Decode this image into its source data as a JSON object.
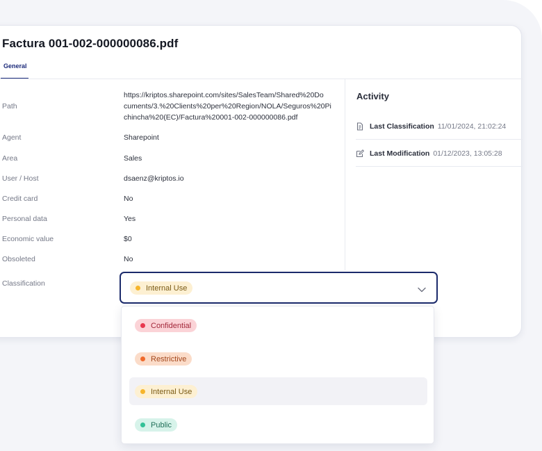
{
  "document": {
    "title": "Factura 001-002-000000086.pdf",
    "tab_general": "General"
  },
  "fields": [
    {
      "label": "Path",
      "value": "https://kriptos.sharepoint.com/sites/SalesTeam/Shared%20Documents/3.%20Clients%20per%20Region/NOLA/Seguros%20Pichincha%20(EC)/Factura%20001-002-000000086.pdf"
    },
    {
      "label": "Agent",
      "value": "Sharepoint"
    },
    {
      "label": "Area",
      "value": "Sales"
    },
    {
      "label": "User / Host",
      "value": "dsaenz@kriptos.io"
    },
    {
      "label": "Credit card",
      "value": "No"
    },
    {
      "label": "Personal data",
      "value": "Yes"
    },
    {
      "label": "Economic value",
      "value": "$0"
    },
    {
      "label": "Obsoleted",
      "value": "No"
    },
    {
      "label": "Classification",
      "value": ""
    }
  ],
  "path_lines": [
    "https://kriptos.sharepoint.com/sites/SalesTeam/Shared%20Do",
    "cuments/3.%20Clients%20per%20Region/NOLA/Seguros%20Pi",
    "chincha%20(EC)/Factura%20001-002-000000086.pdf"
  ],
  "activity": {
    "title": "Activity",
    "items": [
      {
        "label": "Last Classification",
        "date": "11/01/2024, 21:02:24",
        "icon": "document-classify-icon"
      },
      {
        "label": "Last Modification",
        "date": "01/12/2023, 13:05:28",
        "icon": "edit-icon"
      }
    ]
  },
  "classification": {
    "selected": "Internal Use",
    "options": [
      {
        "label": "Confidential",
        "bg": "#fbd3d7",
        "dot": "#e8384f",
        "text": "#a3283a"
      },
      {
        "label": "Restrictive",
        "bg": "#fbdcc9",
        "dot": "#ef6a2c",
        "text": "#a4471c"
      },
      {
        "label": "Internal Use",
        "bg": "#fdf0d2",
        "dot": "#f6b52c",
        "text": "#7a5a14"
      },
      {
        "label": "Public",
        "bg": "#d7f3ea",
        "dot": "#33c197",
        "text": "#1f6f58"
      }
    ]
  },
  "colors": {
    "accent": "#1b2a7a",
    "select_border": "#1b2a6b"
  }
}
